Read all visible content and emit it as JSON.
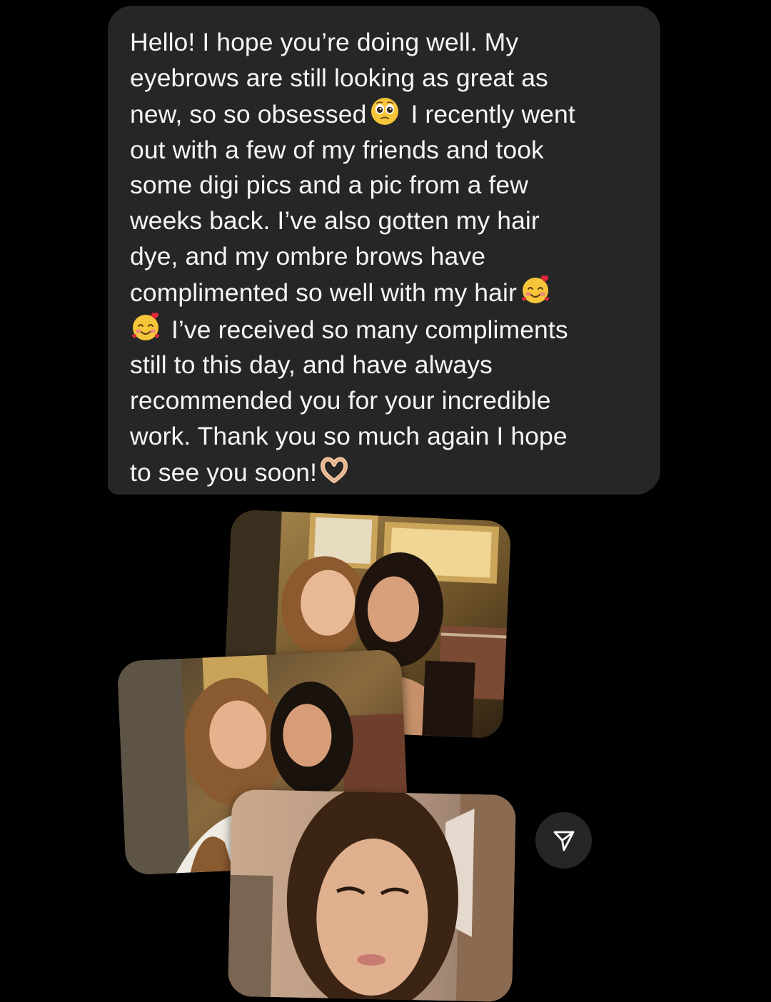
{
  "message": {
    "lines": [
      {
        "text": "Hello! I hope you’re doing well. My"
      },
      {
        "text": "eyebrows are still looking as great as"
      },
      {
        "text": "new, so so obsessed",
        "emoji": "pleading-face-icon",
        "after": " I recently went"
      },
      {
        "text": "out with a few of my friends and took"
      },
      {
        "text": "some digi pics and a pic from a few"
      },
      {
        "text": "weeks back. I’ve also gotten my hair"
      },
      {
        "text": "dye, and my ombre brows have"
      },
      {
        "text": "complimented so well with my hair",
        "emoji": "smiling-face-with-hearts-icon"
      },
      {
        "before_emoji": "smiling-face-with-hearts-icon",
        "text": " I’ve received so many compliments"
      },
      {
        "text": "still to this day, and have always"
      },
      {
        "text": "recommended you for your incredible"
      },
      {
        "text": "work. Thank you so much again I hope"
      },
      {
        "text": "to see you soon!",
        "emoji": "heart-hands-icon"
      }
    ]
  },
  "photos": [
    {
      "name": "photo-two-friends-selfie",
      "icon": "photo-icon"
    },
    {
      "name": "photo-friends-pose",
      "icon": "photo-icon"
    },
    {
      "name": "photo-portrait-selfie",
      "icon": "photo-icon"
    }
  ],
  "share": {
    "icon": "send-icon"
  },
  "colors": {
    "background": "#000000",
    "bubble": "#262626",
    "text": "#f5f5f5"
  }
}
